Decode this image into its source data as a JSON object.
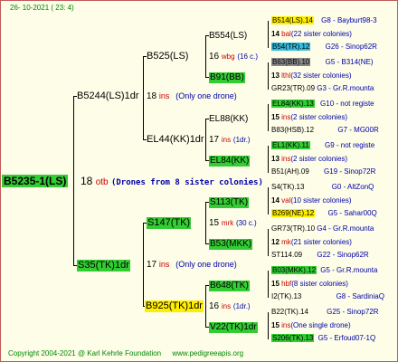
{
  "date": "26- 10-2021 ( 23:  4)",
  "footer": {
    "copyright": "Copyright 2004-2021 @ Karl Kehrle Foundation",
    "site": "www.pedigreeapis.org"
  },
  "root": {
    "id": "B5235-1(LS)",
    "num": "18",
    "tag": "otb",
    "note": "(Drones from 8 sister colonies)"
  },
  "g1": [
    {
      "id": "B5244(LS)1dr",
      "num": "18",
      "tag": "ins",
      "note": "(Only one drone)"
    },
    {
      "id": "S35(TK)1dr",
      "num": "17",
      "tag": "ins",
      "note": "(Only one drone)"
    }
  ],
  "g2": [
    {
      "id": "B525(LS)",
      "num": "16",
      "tag": "wbg",
      "note": "(16 c.)"
    },
    {
      "id": "EL44(KK)1dr",
      "num": "17",
      "tag": "ins",
      "note": "(1dr.)"
    },
    {
      "id": "S147(TK)",
      "num": "15",
      "tag": "mrk",
      "note": "(30 c.)"
    },
    {
      "id": "B925(TK)1dr",
      "num": "16",
      "tag": "ins",
      "note": "(1dr.)"
    }
  ],
  "g3": [
    {
      "id": "B554(LS)",
      "num": "",
      "tag": "",
      "note": ""
    },
    {
      "id": "B91(BB)",
      "num": "",
      "tag": "",
      "note": ""
    },
    {
      "id": "EL88(KK)",
      "num": "",
      "tag": "",
      "note": ""
    },
    {
      "id": "EL84(KK)",
      "num": "",
      "tag": "",
      "note": ""
    },
    {
      "id": "S113(TK)",
      "num": "",
      "tag": "",
      "note": ""
    },
    {
      "id": "B53(MKK)",
      "num": "",
      "tag": "",
      "note": ""
    },
    {
      "id": "B648(TK)",
      "num": "",
      "tag": "",
      "note": ""
    },
    {
      "id": "V22(TK)1dr",
      "num": "",
      "tag": "",
      "note": ""
    }
  ],
  "g4": [
    {
      "id": "B514(LS).14",
      "info": "G8 - Bayburt98-3"
    },
    {
      "id": "14",
      "tag": "bal",
      "note": "(22 sister colonies)"
    },
    {
      "id": "B54(TR).12",
      "info": "G26 - Sinop62R"
    },
    {
      "id": "B63(BB).10",
      "info": "G5 - B314(NE)"
    },
    {
      "id": "13",
      "tag": "lthl",
      "note": "(32 sister colonies)"
    },
    {
      "id": "GR23(TR).09",
      "info": "G3 - Gr.R.mounta"
    },
    {
      "id": "EL84(KK).13",
      "info": "G10 - not registe"
    },
    {
      "id": "15",
      "tag": "ins",
      "note": "(2 sister colonies)"
    },
    {
      "id": "B83(HSB).12",
      "info": "G7 - MG00R"
    },
    {
      "id": "EL1(KK).11",
      "info": "G9 - not registe"
    },
    {
      "id": "13",
      "tag": "ins",
      "note": "(2 sister colonies)"
    },
    {
      "id": "B51(AH).09",
      "info": "G19 - Sinop72R"
    },
    {
      "id": "S4(TK).13",
      "info": "G0 - AltZonQ"
    },
    {
      "id": "14",
      "tag": "val",
      "note": "(10 sister colonies)"
    },
    {
      "id": "B269(NE).12",
      "info": "G5 - Sahar00Q"
    },
    {
      "id": "GR73(TR).10",
      "info": "G4 - Gr.R.mounta"
    },
    {
      "id": "12",
      "tag": "mk",
      "note": "(21 sister colonies)"
    },
    {
      "id": "ST114.09",
      "info": "G22 - Sinop62R"
    },
    {
      "id": "B03(MKK).12",
      "info": "G5 - Gr.R.mounta"
    },
    {
      "id": "15",
      "tag": "hbf",
      "note": "(8 sister colonies)"
    },
    {
      "id": "I2(TK).13",
      "info": "G8 - SardiniaQ"
    },
    {
      "id": "B22(TK).14",
      "info": "G25 - Sinop72R"
    },
    {
      "id": "15",
      "tag": "ins",
      "note": "(One single drone)"
    },
    {
      "id": "S206(TK).13",
      "info": "G5 - Erfoud07-1Q"
    }
  ]
}
